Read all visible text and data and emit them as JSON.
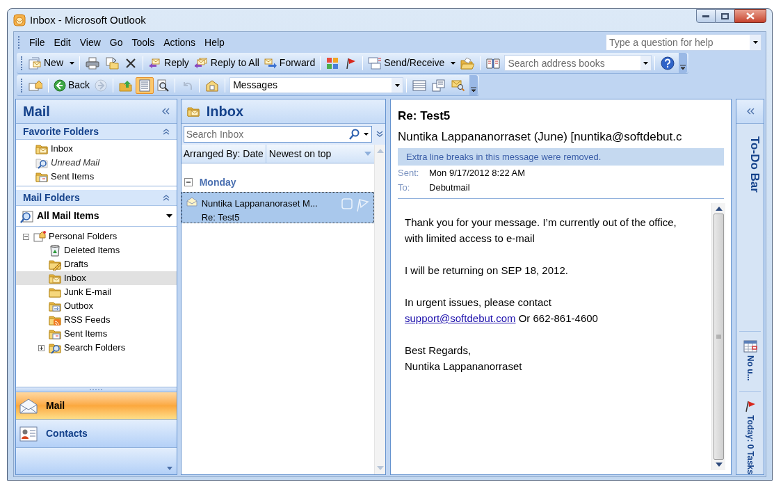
{
  "window": {
    "title": "Inbox - Microsoft Outlook"
  },
  "menu": [
    "File",
    "Edit",
    "View",
    "Go",
    "Tools",
    "Actions",
    "Help"
  ],
  "help_box": {
    "placeholder": "Type a question for help"
  },
  "toolbar_1": [
    {
      "kind": "button",
      "label": "New",
      "dropdown": true
    },
    {
      "kind": "separator"
    },
    {
      "kind": "icon"
    },
    {
      "kind": "icon"
    },
    {
      "kind": "icon"
    },
    {
      "kind": "separator"
    },
    {
      "kind": "button",
      "label": "Reply"
    },
    {
      "kind": "button",
      "label": "Reply to All"
    },
    {
      "kind": "button",
      "label": "Forward"
    },
    {
      "kind": "separator"
    },
    {
      "kind": "icon"
    },
    {
      "kind": "icon"
    },
    {
      "kind": "separator"
    },
    {
      "kind": "button",
      "label": "Send/Receive",
      "dropdown": true
    },
    {
      "kind": "icon"
    },
    {
      "kind": "separator"
    },
    {
      "kind": "icon"
    },
    {
      "kind": "field",
      "placeholder": "Search address books"
    },
    {
      "kind": "separator"
    },
    {
      "kind": "icon"
    }
  ],
  "toolbar_2": [
    {
      "kind": "icon"
    },
    {
      "kind": "separator"
    },
    {
      "kind": "button",
      "label": "Back"
    },
    {
      "kind": "icon",
      "disabled": true
    },
    {
      "kind": "separator"
    },
    {
      "kind": "icon"
    },
    {
      "kind": "icon",
      "selected": true
    },
    {
      "kind": "icon"
    },
    {
      "kind": "separator"
    },
    {
      "kind": "icon",
      "disabled": true
    },
    {
      "kind": "separator"
    },
    {
      "kind": "icon"
    },
    {
      "kind": "separator"
    },
    {
      "kind": "dropdown",
      "value": "Messages"
    },
    {
      "kind": "separator"
    },
    {
      "kind": "icon"
    },
    {
      "kind": "icon"
    },
    {
      "kind": "icon"
    }
  ],
  "navigation_pane": {
    "title": "Mail",
    "favorite_folders": {
      "title": "Favorite Folders",
      "items": [
        {
          "label": "Inbox",
          "kind": "folder",
          "selected": false
        },
        {
          "label": "Unread Mail",
          "kind": "search_folder",
          "selected": false
        },
        {
          "label": "Sent Items",
          "kind": "folder",
          "selected": false
        }
      ]
    },
    "mail_folders": {
      "title": "Mail Folders",
      "view": "All Mail Items",
      "tree": [
        {
          "label": "Personal Folders",
          "expanded": true,
          "selected": false,
          "children": [
            {
              "label": "Deleted Items",
              "selected": false
            },
            {
              "label": "Drafts",
              "selected": false
            },
            {
              "label": "Inbox",
              "selected": true
            },
            {
              "label": "Junk E-mail",
              "selected": false
            },
            {
              "label": "Outbox",
              "selected": false
            },
            {
              "label": "RSS Feeds",
              "selected": false
            },
            {
              "label": "Sent Items",
              "selected": false
            },
            {
              "label": "Search Folders",
              "expanded": false,
              "selected": false
            }
          ]
        }
      ]
    },
    "buttons": [
      {
        "label": "Mail",
        "selected": true
      },
      {
        "label": "Contacts",
        "selected": false
      }
    ]
  },
  "message_list": {
    "title": "Inbox",
    "search": {
      "placeholder": "Search Inbox"
    },
    "arranged_by": "Arranged By: Date",
    "sort_order": "Newest on top",
    "groups": [
      {
        "label": "Monday",
        "expanded": true,
        "messages": [
          {
            "sender": "Nuntika Lappananoraset M...",
            "subject": "Re: Test5",
            "selected": true
          }
        ]
      }
    ]
  },
  "reading_pane": {
    "subject": "Re: Test5",
    "from": "Nuntika Lappananorraset (June) [nuntika@softdebut.c",
    "info_bar": "Extra line breaks in this message were removed.",
    "sent_label": "Sent:",
    "sent": "Mon 9/17/2012 8:22 AM",
    "to_label": "To:",
    "to": "Debutmail",
    "body": [
      {
        "lines": [
          {
            "text": "Thank you for your message. I’m currently out of the office, with limited access to e-mail"
          }
        ]
      },
      {
        "lines": [
          {
            "text": "I will be returning on SEP 18, 2012."
          }
        ]
      },
      {
        "lines": [
          {
            "text": "In urgent issues, please contact"
          },
          {
            "link": "support@softdebut.com",
            "text": " Or 662-861-4600"
          }
        ]
      },
      {
        "lines": [
          {
            "text": "Best Regards,"
          },
          {
            "text": "Nuntika Lappananorraset"
          }
        ]
      }
    ]
  },
  "todo_bar": {
    "title": "To-Do Bar",
    "sections": [
      {
        "label": "No u..."
      },
      {
        "label": "Today: 0 Tasks"
      }
    ]
  }
}
